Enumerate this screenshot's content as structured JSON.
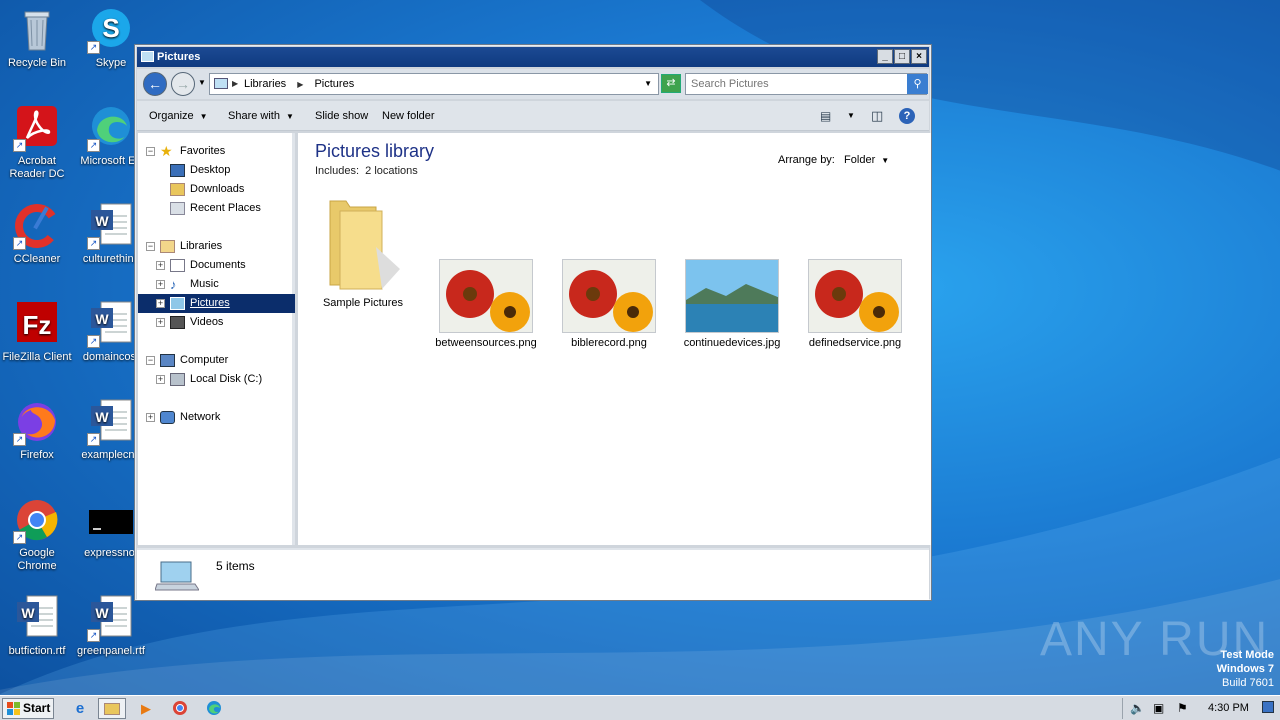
{
  "desktop": {
    "icons": [
      {
        "label": "Recycle Bin",
        "icon": "recycle-bin-icon"
      },
      {
        "label": "Skype",
        "icon": "skype-icon"
      },
      {
        "label": "Acrobat Reader DC",
        "icon": "acrobat-icon"
      },
      {
        "label": "Microsoft Ed",
        "icon": "edge-icon"
      },
      {
        "label": "CCleaner",
        "icon": "ccleaner-icon"
      },
      {
        "label": "culturethink",
        "icon": "word-doc-icon"
      },
      {
        "label": "FileZilla Client",
        "icon": "filezilla-icon"
      },
      {
        "label": "domaincost",
        "icon": "word-doc-icon"
      },
      {
        "label": "Firefox",
        "icon": "firefox-icon"
      },
      {
        "label": "examplecne",
        "icon": "word-doc-icon"
      },
      {
        "label": "Google Chrome",
        "icon": "chrome-icon"
      },
      {
        "label": "expressnot",
        "icon": "console-icon"
      },
      {
        "label": "butfiction.rtf",
        "icon": "word-doc-icon"
      },
      {
        "label": "greenpanel.rtf",
        "icon": "word-doc-icon"
      }
    ]
  },
  "window": {
    "title": "Pictures",
    "controls": {
      "minimize": "_",
      "maximize": "□",
      "close": "×"
    },
    "address": {
      "segments": [
        "Libraries",
        "Pictures"
      ]
    },
    "search": {
      "placeholder": "Search Pictures"
    },
    "toolbar": {
      "organize": "Organize",
      "share_with": "Share with",
      "slide_show": "Slide show",
      "new_folder": "New folder"
    },
    "nav": {
      "favorites": "Favorites",
      "desktop": "Desktop",
      "downloads": "Downloads",
      "recent_places": "Recent Places",
      "libraries": "Libraries",
      "documents": "Documents",
      "music": "Music",
      "pictures": "Pictures",
      "videos": "Videos",
      "computer": "Computer",
      "local_disk": "Local Disk (C:)",
      "network": "Network"
    },
    "content": {
      "title": "Pictures library",
      "includes_label": "Includes:",
      "includes_value": "2 locations",
      "arrange_label": "Arrange by:",
      "arrange_value": "Folder",
      "files": [
        {
          "name": "Sample Pictures",
          "kind": "folder"
        },
        {
          "name": "betweensources.png",
          "kind": "flowers"
        },
        {
          "name": "biblerecord.png",
          "kind": "flowers"
        },
        {
          "name": "continuedevices.jpg",
          "kind": "landscape"
        },
        {
          "name": "definedservice.png",
          "kind": "flowers"
        }
      ]
    },
    "status": {
      "items_count": "5 items"
    }
  },
  "watermark": {
    "brand": "ANY RUN"
  },
  "testmode": {
    "line1": "Test Mode",
    "line2": "Windows 7",
    "line3": "Build 7601"
  },
  "taskbar": {
    "start_label": "Start",
    "clock": "4:30 PM"
  }
}
